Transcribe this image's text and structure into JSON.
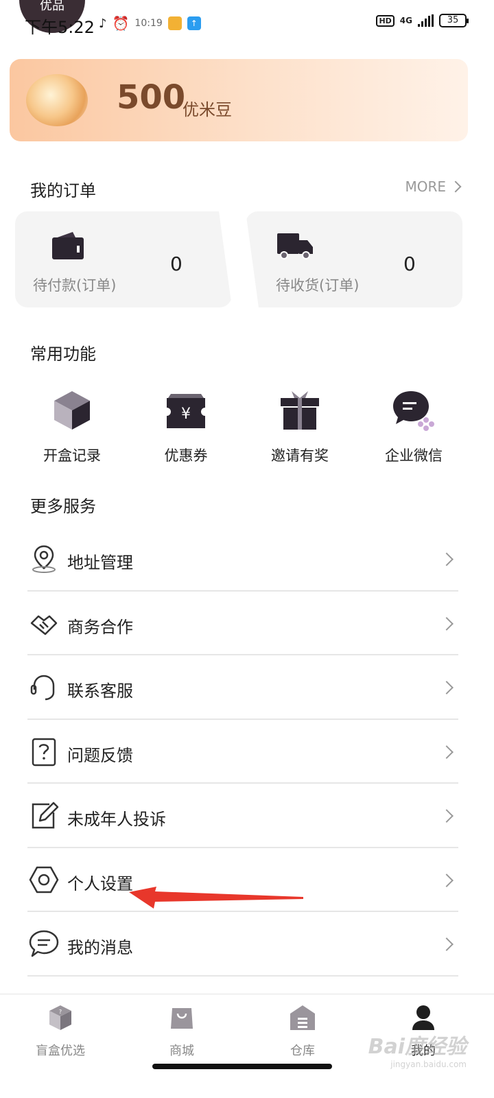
{
  "status_bar": {
    "time": "下午5:22",
    "avatar_text": "优品",
    "small_text": "10:19",
    "network": "4G",
    "hd": "HD",
    "battery": "35"
  },
  "points": {
    "value": "500",
    "unit": "优米豆"
  },
  "orders": {
    "title": "我的订单",
    "more": "MORE",
    "items": [
      {
        "label": "待付款(订单)",
        "count": "0",
        "icon": "wallet-icon"
      },
      {
        "label": "待收货(订单)",
        "count": "0",
        "icon": "truck-icon"
      }
    ]
  },
  "functions": {
    "title": "常用功能",
    "items": [
      {
        "label": "开盒记录",
        "icon": "box-icon"
      },
      {
        "label": "优惠券",
        "icon": "coupon-icon"
      },
      {
        "label": "邀请有奖",
        "icon": "gift-icon"
      },
      {
        "label": "企业微信",
        "icon": "wecom-icon"
      }
    ]
  },
  "services": {
    "title": "更多服务",
    "items": [
      {
        "label": "地址管理",
        "icon": "location-icon"
      },
      {
        "label": "商务合作",
        "icon": "handshake-icon"
      },
      {
        "label": "联系客服",
        "icon": "headset-icon"
      },
      {
        "label": "问题反馈",
        "icon": "question-icon"
      },
      {
        "label": "未成年人投诉",
        "icon": "edit-icon"
      },
      {
        "label": "个人设置",
        "icon": "hexagon-settings-icon"
      },
      {
        "label": "我的消息",
        "icon": "message-icon"
      }
    ]
  },
  "tabbar": {
    "items": [
      {
        "label": "盲盒优选",
        "icon": "blindbox-icon"
      },
      {
        "label": "商城",
        "icon": "shopping-bag-icon"
      },
      {
        "label": "仓库",
        "icon": "warehouse-icon"
      },
      {
        "label": "我的",
        "icon": "user-icon",
        "active": true
      }
    ]
  },
  "watermark": {
    "text": "Bai度经验",
    "sub": "jingyan.baidu.com"
  },
  "colors": {
    "card_gradient_start": "#fbc7a0",
    "points_text": "#7a4a2c",
    "icon_dark": "#2b2530",
    "annotation_arrow": "#e8372b"
  }
}
